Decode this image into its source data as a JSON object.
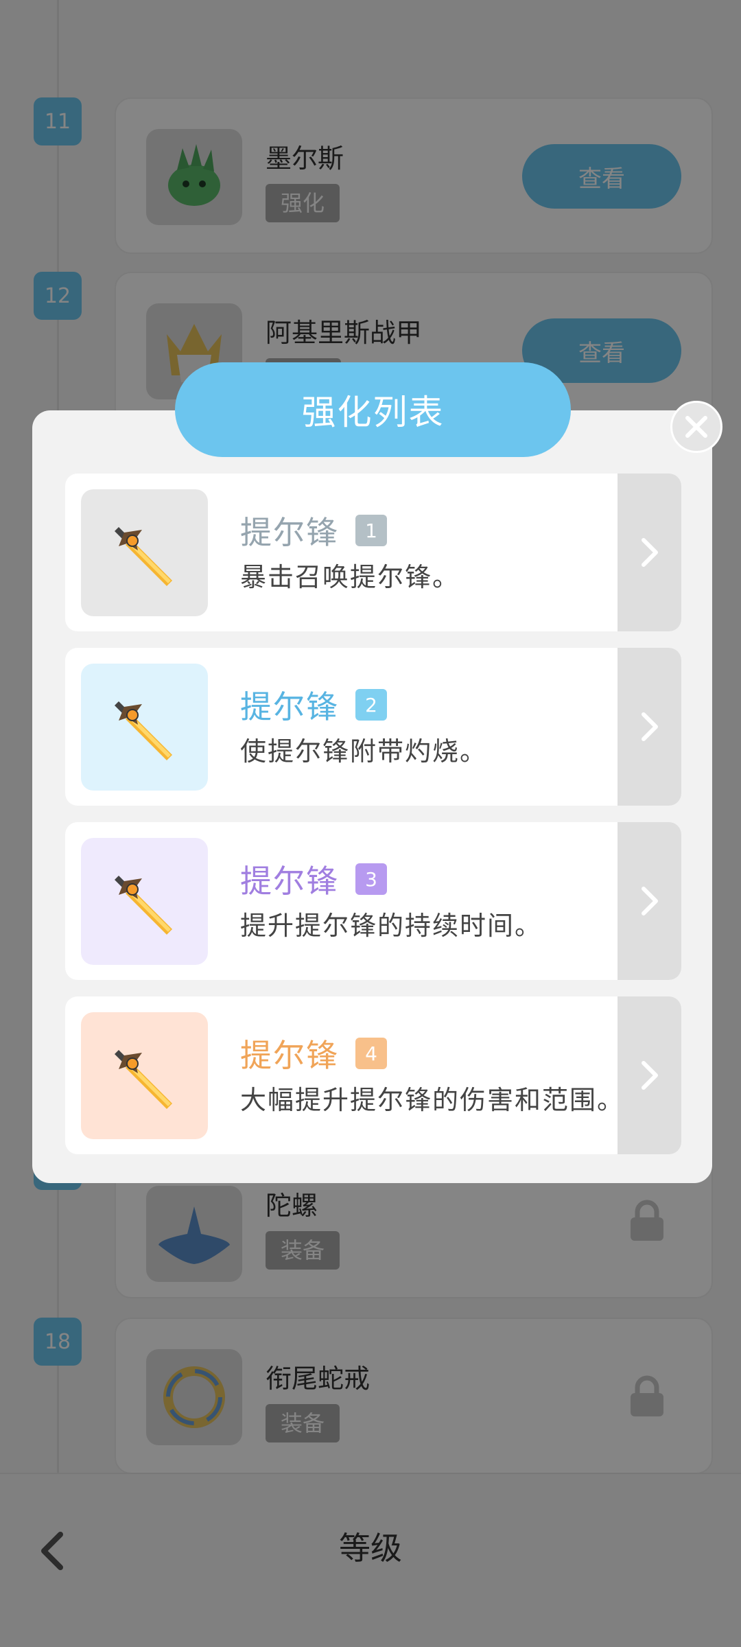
{
  "background_list": {
    "items": [
      {
        "level": "11",
        "name": "墨尔斯",
        "tag": "强化",
        "button": "查看",
        "locked": false
      },
      {
        "level": "12",
        "name": "阿基里斯战甲",
        "tag": "",
        "button": "查看",
        "locked": false
      },
      {
        "level": "",
        "name": "陀螺",
        "tag": "装备",
        "button": "",
        "locked": true
      },
      {
        "level": "18",
        "name": "衔尾蛇戒",
        "tag": "装备",
        "button": "",
        "locked": true
      }
    ]
  },
  "bottom_bar": {
    "title": "等级",
    "back_icon": "chevron-left-icon"
  },
  "modal": {
    "title": "强化列表",
    "close_icon": "close-icon",
    "upgrades": [
      {
        "name": "提尔锋",
        "level": "1",
        "desc": "暴击召唤提尔锋。",
        "color": "#95a4ae",
        "badge_color": "#b4c0c6",
        "bg": "#e7e7e7"
      },
      {
        "name": "提尔锋",
        "level": "2",
        "desc": "使提尔锋附带灼烧。",
        "color": "#58b4e2",
        "badge_color": "#7fd0f1",
        "bg": "#def3fd"
      },
      {
        "name": "提尔锋",
        "level": "3",
        "desc": "提升提尔锋的持续时间。",
        "color": "#a07ee0",
        "badge_color": "#b79af0",
        "bg": "#efeafd"
      },
      {
        "name": "提尔锋",
        "level": "4",
        "desc": "大幅提升提尔锋的伤害和范围。",
        "color": "#f0a458",
        "badge_color": "#f8c08a",
        "bg": "#ffe3d5"
      }
    ]
  },
  "colors": {
    "accent": "#6cc5ee",
    "overlay": "rgba(0,0,0,0.48)"
  }
}
